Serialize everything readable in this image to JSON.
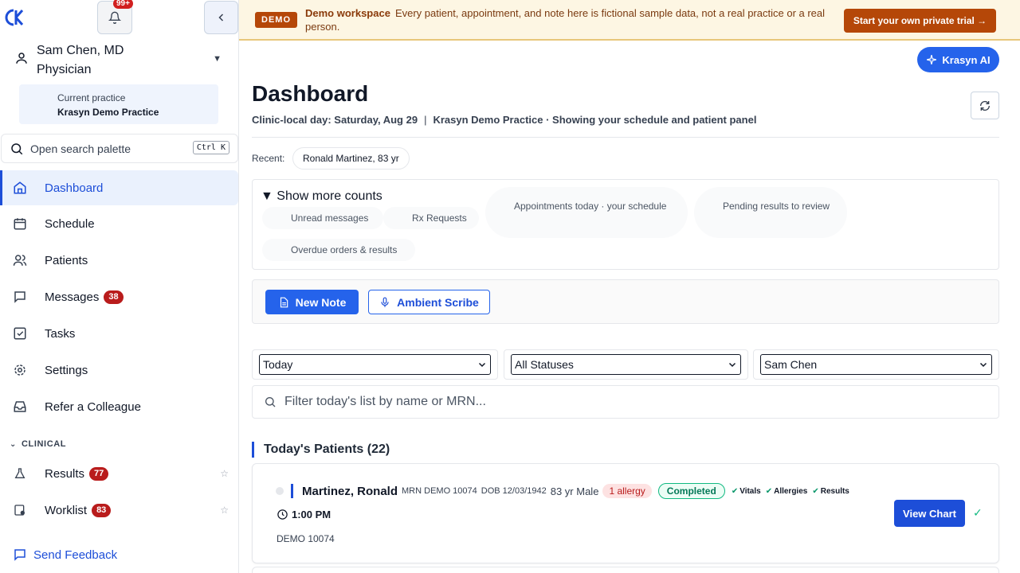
{
  "header": {
    "notification_count": "99+",
    "user_name": "Sam Chen, MD",
    "user_role": "Physician",
    "practice_label": "Current practice",
    "practice_name": "Krasyn Demo Practice"
  },
  "search": {
    "label": "Open search palette",
    "shortcut": "Ctrl K"
  },
  "nav": {
    "items": [
      {
        "label": "Dashboard",
        "icon": "home-icon"
      },
      {
        "label": "Schedule",
        "icon": "calendar-icon"
      },
      {
        "label": "Patients",
        "icon": "users-icon"
      },
      {
        "label": "Messages",
        "icon": "message-icon",
        "badge": "38"
      },
      {
        "label": "Tasks",
        "icon": "checkbox-icon"
      },
      {
        "label": "Settings",
        "icon": "gear-icon"
      },
      {
        "label": "Refer a Colleague",
        "icon": "inbox-icon"
      }
    ],
    "section": "CLINICAL",
    "clinical": [
      {
        "label": "Results",
        "icon": "flask-icon",
        "badge": "77"
      },
      {
        "label": "Worklist",
        "icon": "worklist-icon",
        "badge": "83"
      }
    ],
    "feedback": "Send Feedback"
  },
  "banner": {
    "tag": "DEMO",
    "title": "Demo workspace",
    "text": "Every patient, appointment, and note here is fictional sample data, not a real practice or a real person.",
    "cta": "Start your own private trial →"
  },
  "main": {
    "ai_button": "Krasyn AI",
    "title": "Dashboard",
    "subtitle_day": "Clinic-local day: Saturday, Aug 29",
    "subtitle_sep": "|",
    "subtitle_practice": "Krasyn Demo Practice · Showing your schedule and patient panel",
    "recent_label": "Recent:",
    "recent_chip": "Ronald Martinez, 83 yr",
    "counts": {
      "toggle": "▼ Show more counts",
      "unread": "Unread messages",
      "rx": "Rx Requests",
      "appointments": "Appointments today · your schedule",
      "pending": "Pending results to review",
      "overdue": "Overdue orders & results"
    },
    "actions": {
      "new_note": "New Note",
      "scribe": "Ambient Scribe"
    },
    "filters": {
      "date": "Today",
      "status": "All Statuses",
      "provider": "Sam Chen",
      "search_placeholder": "Filter today's list by name or MRN..."
    },
    "list_title": "Today's Patients (22)",
    "patient": {
      "name": "Martinez, Ronald",
      "mrn": "MRN DEMO 10074",
      "dob": "DOB 12/03/1942",
      "demo": "83 yr Male",
      "allergy": "1 allergy",
      "status": "Completed",
      "checks": [
        "Vitals",
        "Allergies",
        "Results"
      ],
      "time": "1:00 PM",
      "mrn_short": "DEMO 10074",
      "view_chart": "View Chart"
    }
  },
  "colors": {
    "primary": "#2563eb",
    "badge": "#b91c1c",
    "banner_bg": "#fdf6e3",
    "banner_accent": "#b54708",
    "success": "#10b981"
  }
}
